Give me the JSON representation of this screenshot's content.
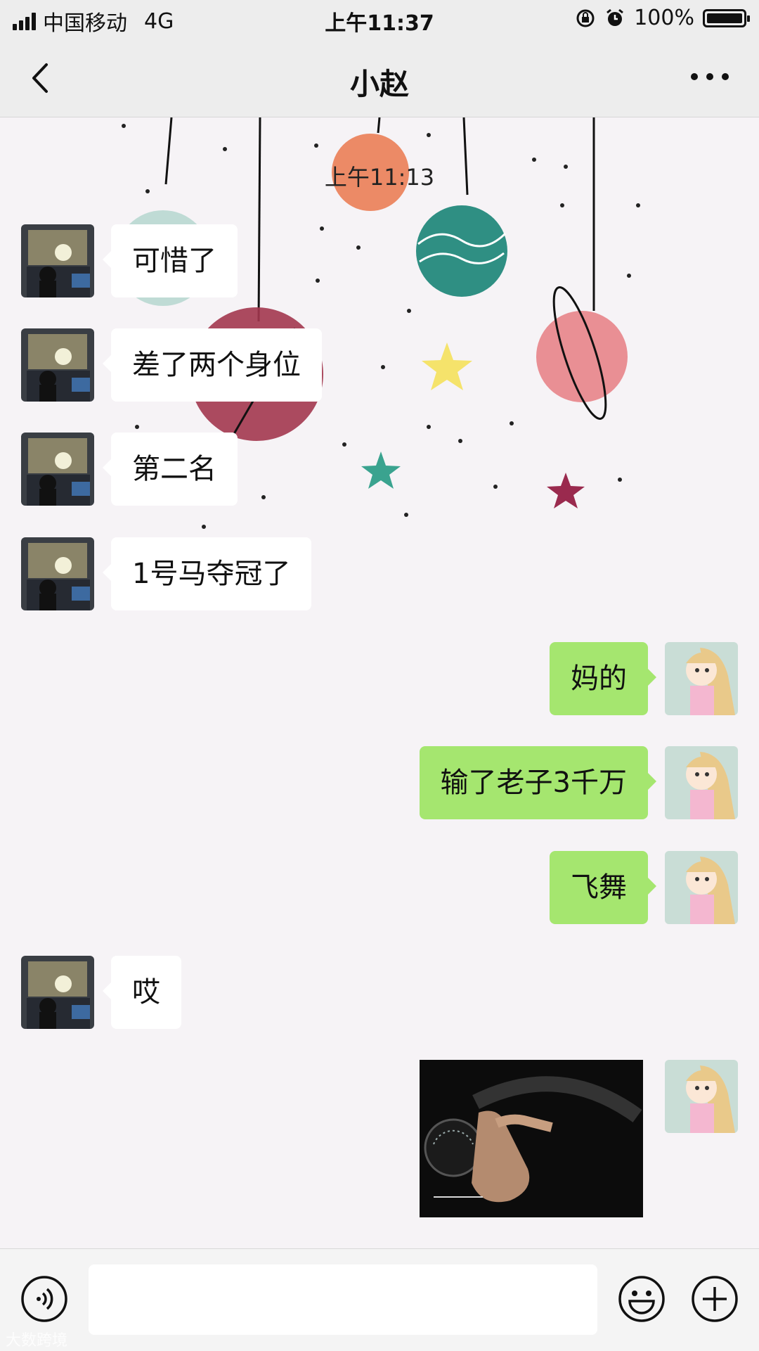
{
  "status_bar": {
    "carrier": "中国移动",
    "network": "4G",
    "time": "上午11:37",
    "battery_percent": "100%",
    "battery_level": 1.0
  },
  "nav": {
    "title": "小赵",
    "back_icon": "chevron-left-icon",
    "more_icon": "ellipsis-icon"
  },
  "chat": {
    "timestamp": "上午11:13",
    "messages": [
      {
        "side": "in",
        "text": "可惜了"
      },
      {
        "side": "in",
        "text": "差了两个身位"
      },
      {
        "side": "in",
        "text": "第二名"
      },
      {
        "side": "in",
        "text": "1号马夺冠了"
      },
      {
        "side": "out",
        "text": "妈的"
      },
      {
        "side": "out",
        "text": "输了老子3千万"
      },
      {
        "side": "out",
        "text": "飞舞"
      },
      {
        "side": "in",
        "text": "哎"
      },
      {
        "side": "out",
        "type": "image",
        "image": "car-steering-wheel-gif"
      }
    ]
  },
  "input_bar": {
    "voice_icon": "voice-icon",
    "emoji_icon": "emoji-icon",
    "plus_icon": "plus-icon"
  },
  "colors": {
    "outgoing_bubble": "#a5e66f",
    "incoming_bubble": "#ffffff",
    "bar_background": "#ededed"
  },
  "watermark": "大数跨境"
}
